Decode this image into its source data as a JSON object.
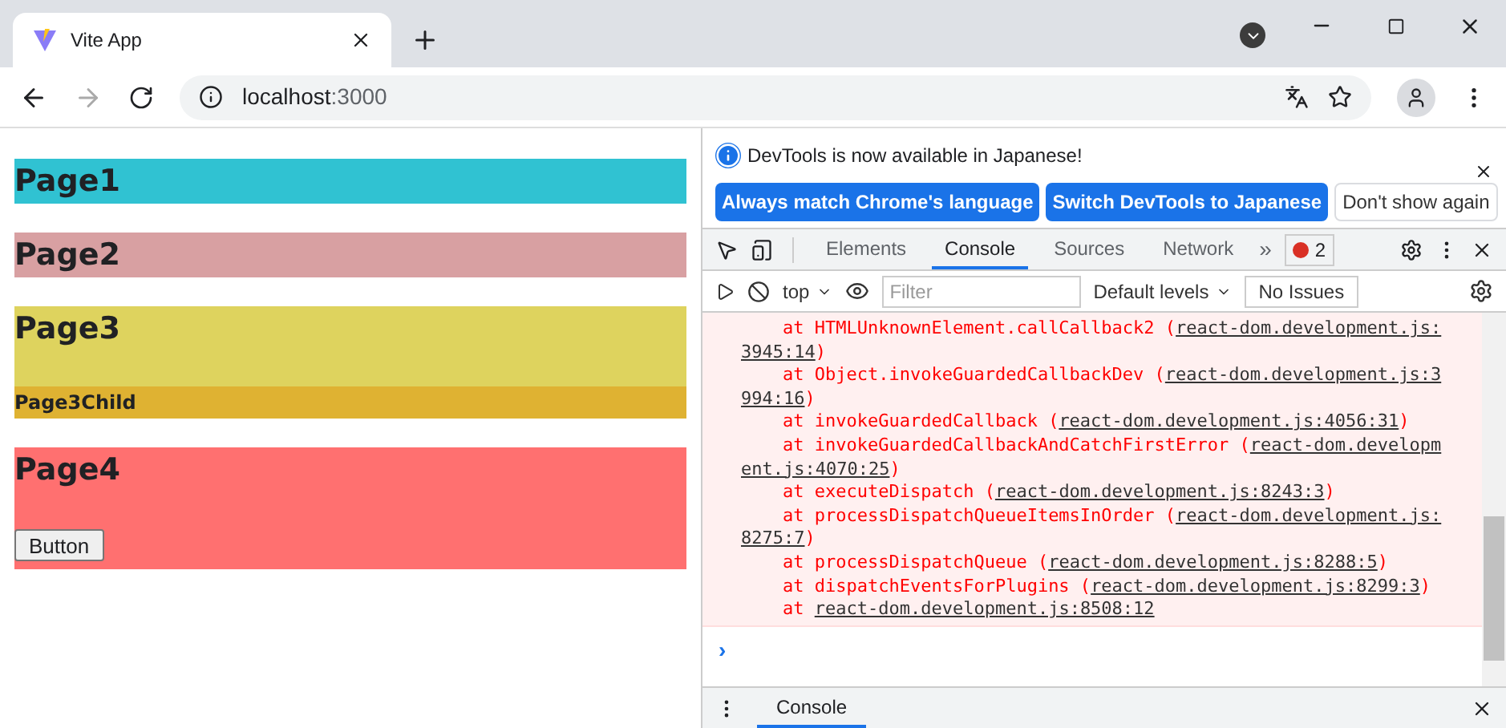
{
  "browser": {
    "tab_title": "Vite App",
    "url_host": "localhost",
    "url_port": ":3000"
  },
  "page": {
    "sections": [
      {
        "title": "Page1",
        "color": "#30c2d2"
      },
      {
        "title": "Page2",
        "color": "#d8a0a2"
      },
      {
        "title": "Page3",
        "color": "#ded35e",
        "child": {
          "title": "Page3Child",
          "color": "#dfb232"
        }
      },
      {
        "title": "Page4",
        "color": "#ff7070",
        "button": "Button"
      }
    ]
  },
  "devtools": {
    "infobar": {
      "message": "DevTools is now available in Japanese!",
      "buttons": [
        {
          "label": "Always match Chrome's language",
          "kind": "primary"
        },
        {
          "label": "Switch DevTools to Japanese",
          "kind": "primary"
        },
        {
          "label": "Don't show again",
          "kind": "secondary"
        }
      ]
    },
    "tabs": [
      {
        "label": "Elements",
        "selected": false
      },
      {
        "label": "Console",
        "selected": true
      },
      {
        "label": "Sources",
        "selected": false
      },
      {
        "label": "Network",
        "selected": false
      }
    ],
    "more_tabs": "»",
    "error_count": "2",
    "console_toolbar": {
      "context": "top",
      "filter_placeholder": "Filter",
      "levels": "Default levels",
      "issues": "No Issues"
    },
    "log_lines": [
      {
        "text": "at HTMLUnknownElement.callCallback2 (",
        "link_parts": [
          "react-dom.development.js:",
          "3945:14"
        ],
        "close": ")"
      },
      {
        "text": "at Object.invokeGuardedCallbackDev (",
        "link_parts": [
          "react-dom.development.js:3",
          "994:16"
        ],
        "close": ")"
      },
      {
        "text": "at invokeGuardedCallback (",
        "link_parts": [
          "react-dom.development.js:4056:31"
        ],
        "close": ")"
      },
      {
        "text": "at invokeGuardedCallbackAndCatchFirstError (",
        "link_parts": [
          "react-dom.developm",
          "ent.js:4070:25"
        ],
        "close": ")"
      },
      {
        "text": "at executeDispatch (",
        "link_parts": [
          "react-dom.development.js:8243:3"
        ],
        "close": ")"
      },
      {
        "text": "at processDispatchQueueItemsInOrder (",
        "link_parts": [
          "react-dom.development.js:",
          "8275:7"
        ],
        "close": ")"
      },
      {
        "text": "at processDispatchQueue (",
        "link_parts": [
          "react-dom.development.js:8288:5"
        ],
        "close": ")"
      },
      {
        "text": "at dispatchEventsForPlugins (",
        "link_parts": [
          "react-dom.development.js:8299:3"
        ],
        "close": ")"
      },
      {
        "text": "at ",
        "link_parts": [
          "react-dom.development.js:8508:12"
        ]
      }
    ],
    "prompt": "›",
    "drawer_tab": "Console"
  }
}
